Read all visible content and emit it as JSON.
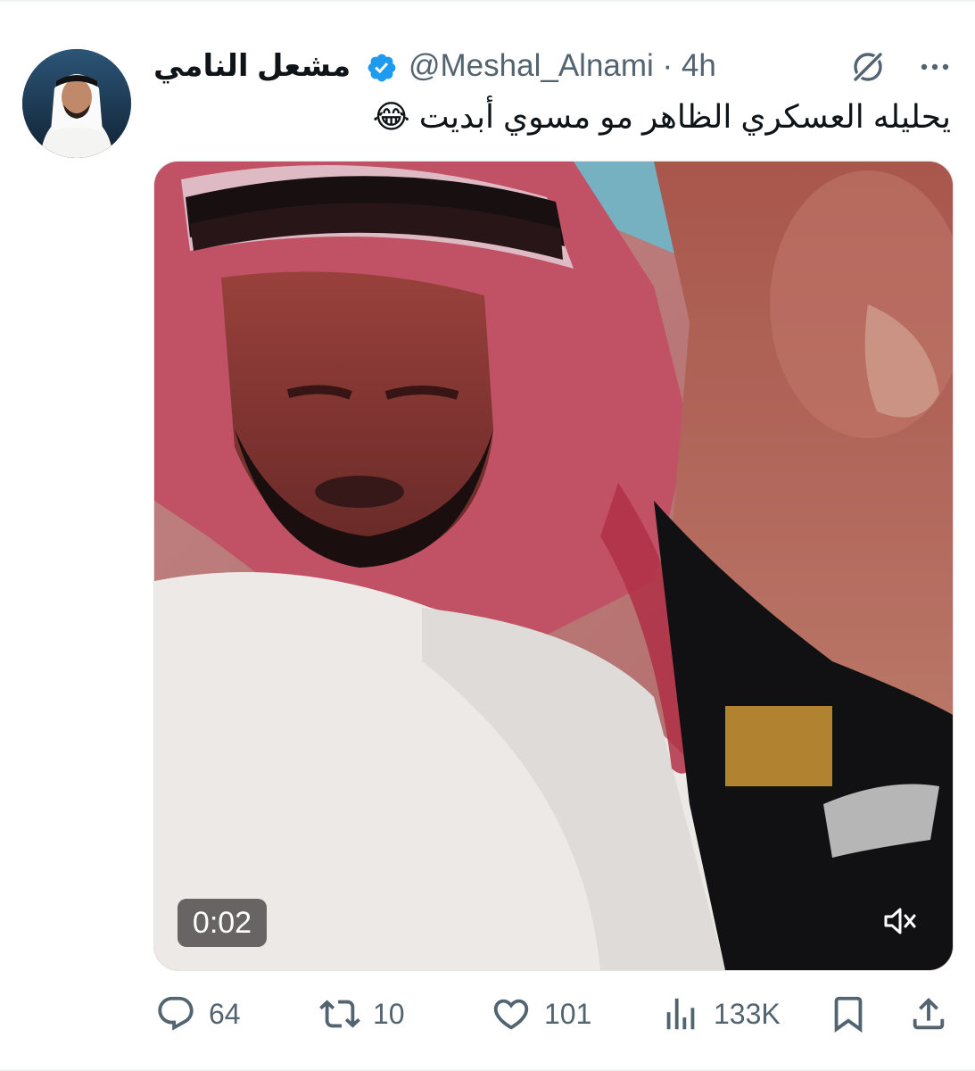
{
  "tweet": {
    "author_name": "مشعل النامي",
    "handle_time": "@Meshal_Alnami · 4h",
    "text": "يحليله العسكري الظاهر مو مسوي أبديت 😂"
  },
  "media": {
    "timestamp": "0:02"
  },
  "actions": {
    "replies": "64",
    "reposts": "10",
    "likes": "101",
    "views": "133K"
  },
  "colors": {
    "verified": "#1d9bf0",
    "secondary_text": "#536471"
  }
}
